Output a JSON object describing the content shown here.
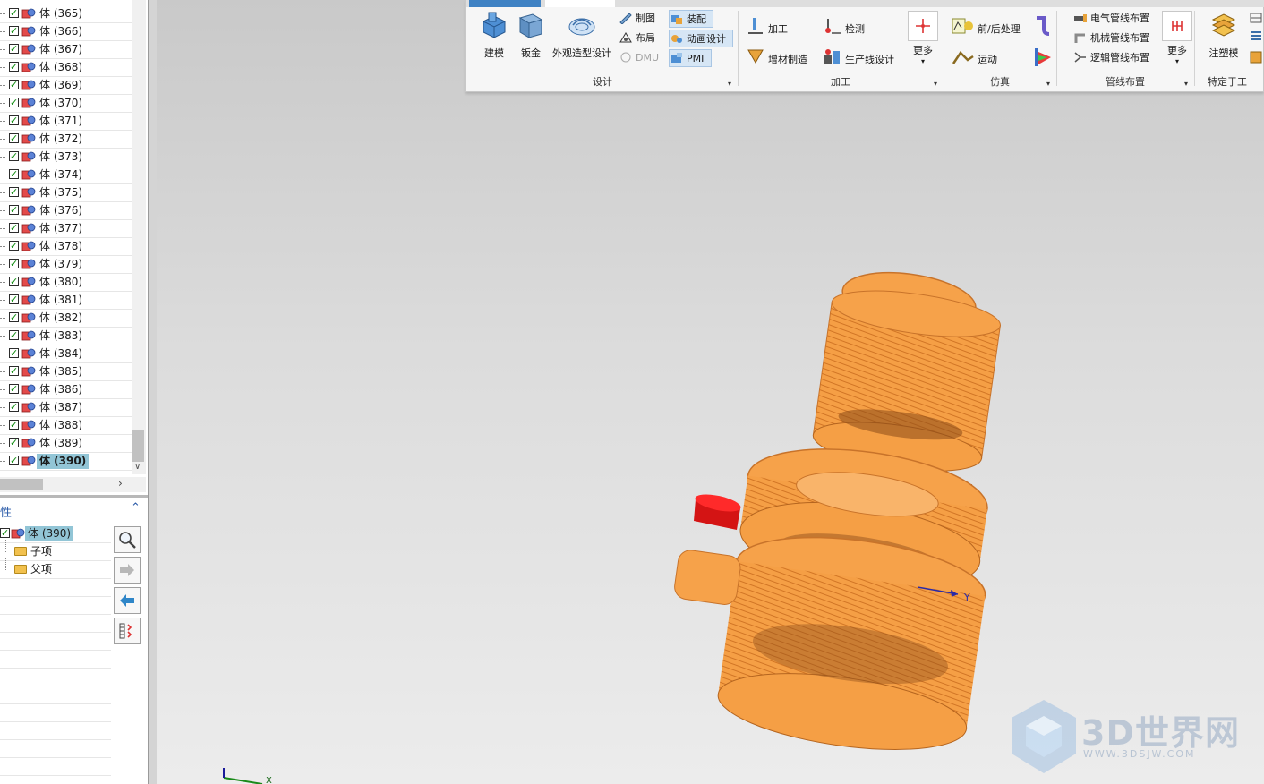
{
  "navigator": {
    "rows": [
      {
        "label": "体 (365)"
      },
      {
        "label": "体 (366)"
      },
      {
        "label": "体 (367)"
      },
      {
        "label": "体 (368)"
      },
      {
        "label": "体 (369)"
      },
      {
        "label": "体 (370)"
      },
      {
        "label": "体 (371)"
      },
      {
        "label": "体 (372)"
      },
      {
        "label": "体 (373)"
      },
      {
        "label": "体 (374)"
      },
      {
        "label": "体 (375)"
      },
      {
        "label": "体 (376)"
      },
      {
        "label": "体 (377)"
      },
      {
        "label": "体 (378)"
      },
      {
        "label": "体 (379)"
      },
      {
        "label": "体 (380)"
      },
      {
        "label": "体 (381)"
      },
      {
        "label": "体 (382)"
      },
      {
        "label": "体 (383)"
      },
      {
        "label": "体 (384)"
      },
      {
        "label": "体 (385)"
      },
      {
        "label": "体 (386)"
      },
      {
        "label": "体 (387)"
      },
      {
        "label": "体 (388)"
      },
      {
        "label": "体 (389)"
      },
      {
        "label": "体 (390)"
      }
    ],
    "selected_label": "体 (390)"
  },
  "dependency_panel": {
    "title_fragment": "性",
    "node_label": "体 (390)",
    "children_label": "子项",
    "parents_label": "父项"
  },
  "ribbon": {
    "groups": {
      "design": {
        "label": "设计",
        "modeling": "建模",
        "sheetmetal": "钣金",
        "shape_design": "外观造型设计",
        "drawing": "制图",
        "layout": "布局",
        "dmu": "DMU",
        "assembly": "装配",
        "motion_design": "动画设计",
        "pmi": "PMI"
      },
      "machining": {
        "label": "加工",
        "machining": "加工",
        "inspection": "检测",
        "additive": "增材制造",
        "line_design": "生产线设计",
        "more": "更多"
      },
      "simulation": {
        "label": "仿真",
        "pre_post": "前/后处理",
        "motion": "运动"
      },
      "routing": {
        "label": "管线布置",
        "electrical": "电气管线布置",
        "mechanical": "机械管线布置",
        "logical": "逻辑管线布置",
        "more": "更多"
      },
      "industry": {
        "label": "特定于工",
        "injection_mold": "注塑模"
      }
    }
  },
  "viewport": {
    "triad_label": "Y",
    "axis_label": "X",
    "watermark_text": "3D世界网",
    "watermark_url": "WWW.3DSJW.COM",
    "model_color": "#f59f45",
    "highlight_color": "#e81818"
  }
}
